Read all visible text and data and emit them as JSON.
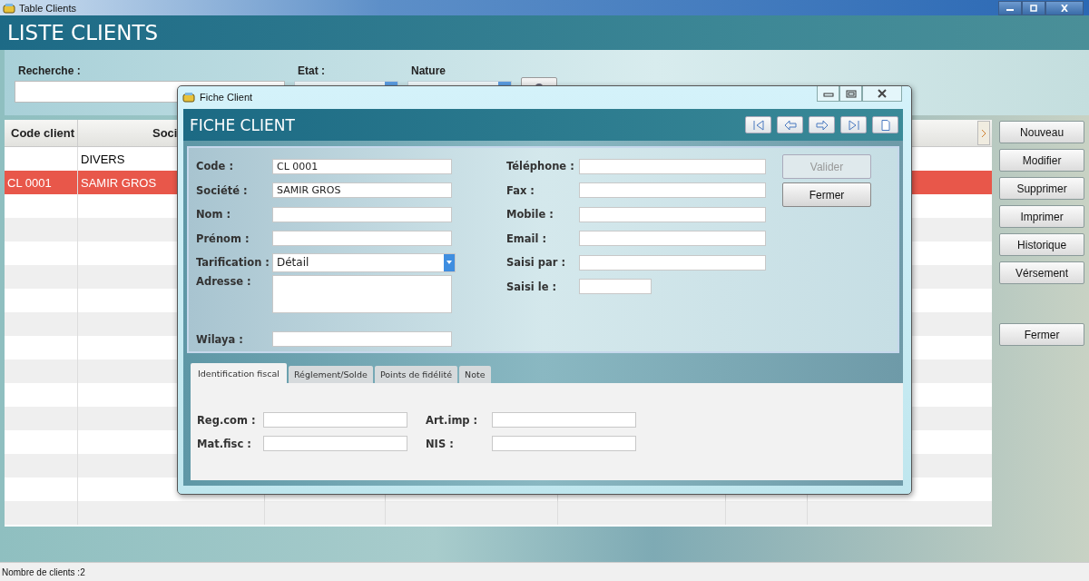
{
  "window": {
    "title": "Table Clients",
    "heading": "LISTE CLIENTS"
  },
  "filters": [
    {
      "label": "Recherche :",
      "kind": "text"
    },
    {
      "label": "Etat :",
      "kind": "combo"
    },
    {
      "label": "Nature",
      "kind": "combo"
    }
  ],
  "table": {
    "columns": [
      "Code client",
      "Soci"
    ],
    "rows": [
      {
        "column_2": "DIVERS",
        "selected": false
      },
      {
        "column_1": "CL 0001",
        "column_2": "SAMIR GROS",
        "selected": true
      }
    ]
  },
  "actions": [
    "Nouveau",
    "Modifier",
    "Supprimer",
    "Imprimer",
    "Historique",
    "Vérsement"
  ],
  "close_button": "Fermer",
  "dialog": {
    "title": "Fiche Client",
    "heading": "FICHE CLIENT",
    "left_fields": [
      {
        "label": "Code :",
        "value": "CL 0001",
        "kind": "text"
      },
      {
        "label": "Société :",
        "value": "SAMIR GROS",
        "kind": "text"
      },
      {
        "label": "Nom :",
        "kind": "text"
      },
      {
        "label": "Prénom :",
        "kind": "text"
      },
      {
        "label": "Tarification :",
        "value": "Détail",
        "kind": "combo"
      },
      {
        "label": "Adresse :",
        "kind": "area"
      },
      {
        "label": "Wilaya :",
        "kind": "text"
      }
    ],
    "right_fields": [
      {
        "label": "Téléphone :",
        "kind": "text"
      },
      {
        "label": "Fax :",
        "kind": "text"
      },
      {
        "label": "Mobile :",
        "kind": "text"
      },
      {
        "label": "Email :",
        "kind": "text"
      },
      {
        "label": "Saisi par :",
        "kind": "text"
      },
      {
        "label": "Saisi le :",
        "kind": "short"
      }
    ],
    "buttons": [
      {
        "label": "Valider",
        "disabled": true
      },
      {
        "label": "Fermer",
        "disabled": false
      }
    ],
    "tabs": [
      {
        "label": "Identification fiscal",
        "selected": true
      },
      {
        "label": "Réglement/Solde",
        "selected": false
      },
      {
        "label": "Points de fidélité",
        "selected": false
      },
      {
        "label": "Note",
        "selected": false
      }
    ],
    "tab_fields": [
      {
        "label": "Reg.com :"
      },
      {
        "label": "Art.imp :"
      },
      {
        "label": "Mat.fisc :"
      },
      {
        "label": "NIS :"
      }
    ]
  },
  "status_bar": "Nombre de clients :2"
}
